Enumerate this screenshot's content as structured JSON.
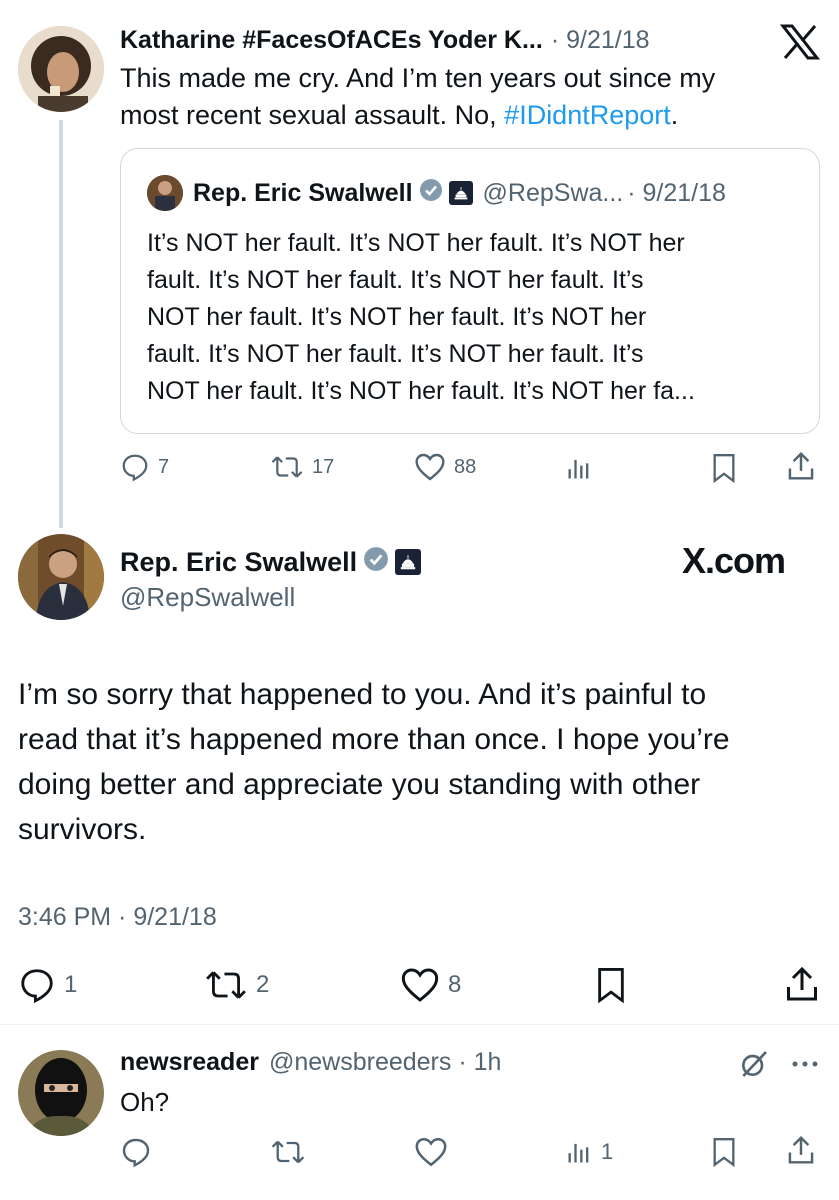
{
  "tweet1": {
    "name": "Katharine #FacesOfACEs Yoder K...",
    "date": "· 9/21/18",
    "text_line1": "This made me cry. And I’m ten years out since my",
    "text_line2_pre": "most recent sexual assault. No, ",
    "hashtag": "#IDidntReport",
    "text_line2_post": ".",
    "quote": {
      "name": "Rep. Eric Swalwell",
      "handle": "@RepSwa...",
      "date": "· 9/21/18",
      "lines": [
        "It’s NOT her fault. It’s NOT her fault. It’s NOT her",
        "fault. It’s NOT her fault. It’s NOT her fault. It’s",
        "NOT her fault. It’s NOT her fault. It’s NOT her",
        "fault. It’s NOT her fault. It’s NOT her fault. It’s",
        "NOT her fault. It’s NOT her fault. It’s NOT her fa..."
      ]
    },
    "actions": {
      "replies": "7",
      "retweets": "17",
      "likes": "88"
    }
  },
  "main_tweet": {
    "name": "Rep. Eric Swalwell",
    "handle": "@RepSwalwell",
    "brand": "X.com",
    "lines": [
      "I’m so sorry that happened to you. And it’s painful to",
      "read that it’s happened more than once. I hope you’re",
      "doing better and appreciate you standing with other",
      "survivors."
    ],
    "timestamp": "3:46 PM · 9/21/18",
    "actions": {
      "replies": "1",
      "retweets": "2",
      "likes": "8"
    }
  },
  "reply": {
    "name": "newsreader",
    "handle": "@newsbreeders · 1h",
    "text": "Oh?",
    "actions": {
      "views": "1"
    }
  },
  "colors": {
    "text": "#0f1419",
    "secondary": "#536471",
    "link": "#1d9bf0",
    "verified": "#829aab",
    "border": "#cfd9de"
  },
  "icons": {
    "x_logo": "x-logo-icon",
    "reply": "reply-icon",
    "retweet": "retweet-icon",
    "like": "heart-icon",
    "views": "views-icon",
    "bookmark": "bookmark-icon",
    "share": "share-icon",
    "grok": "grok-icon",
    "more": "more-icon"
  }
}
